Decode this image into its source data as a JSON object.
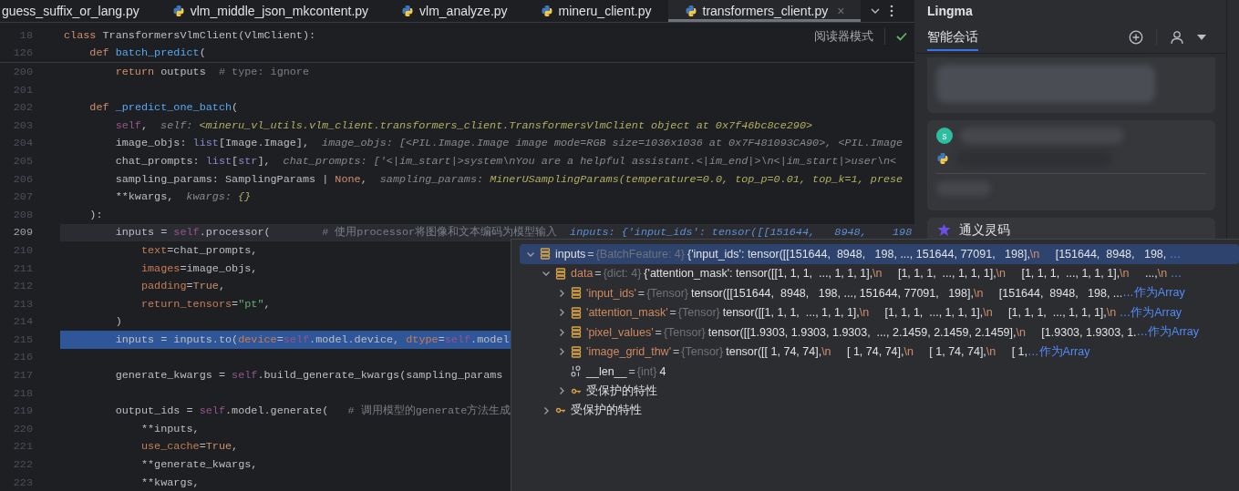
{
  "tabs": [
    {
      "label": "guess_suffix_or_lang.py",
      "icon": false,
      "selected": false
    },
    {
      "label": "vlm_middle_json_mkcontent.py",
      "icon": true,
      "selected": false
    },
    {
      "label": "vlm_analyze.py",
      "icon": true,
      "selected": false
    },
    {
      "label": "mineru_client.py",
      "icon": true,
      "selected": false
    },
    {
      "label": "transformers_client.py",
      "icon": true,
      "selected": true,
      "close": "×"
    }
  ],
  "editor": {
    "reader_mode": "阅读器模式",
    "sticky_lines": [
      {
        "number": "18",
        "execution_point": false,
        "caret_line": false,
        "tokens": [
          {
            "text": "class",
            "kind": "kw"
          },
          {
            "text": " TransformersVlmClient(VlmClient):",
            "kind": "plain"
          }
        ]
      },
      {
        "number": "126",
        "execution_point": false,
        "caret_line": false,
        "tokens": [
          {
            "text": "    def",
            "kind": "kw"
          },
          {
            "text": " batch_predict",
            "kind": "fn"
          },
          {
            "text": "(",
            "kind": "plain"
          }
        ]
      }
    ],
    "lines": [
      {
        "number": "200",
        "execution_point": false,
        "caret_line": false,
        "tokens": [
          {
            "text": "        return",
            "kind": "kw"
          },
          {
            "text": " outputs  ",
            "kind": "plain"
          },
          {
            "text": "# type: ignore",
            "kind": "cmt"
          }
        ]
      },
      {
        "number": "201",
        "execution_point": false,
        "caret_line": false
      },
      {
        "number": "202",
        "execution_point": false,
        "caret_line": false,
        "tokens": [
          {
            "text": "    def",
            "kind": "kw"
          },
          {
            "text": " _predict_one_batch",
            "kind": "fn"
          },
          {
            "text": "(",
            "kind": "plain"
          }
        ]
      },
      {
        "number": "203",
        "execution_point": false,
        "caret_line": false,
        "tokens": [
          {
            "text": "        self",
            "kind": "self"
          },
          {
            "text": ",",
            "kind": "plain"
          }
        ],
        "hint": {
          "kind": "inlay",
          "segments": [
            {
              "text": "self: ",
              "kind": "name"
            },
            {
              "text": "<mineru_vl_utils.vlm_client.transformers_client.TransformersVlmClient object at 0x7f46bc8ce290>",
              "kind": "value"
            }
          ]
        }
      },
      {
        "number": "204",
        "execution_point": false,
        "caret_line": false,
        "tokens": [
          {
            "text": "        image_objs: ",
            "kind": "plain"
          },
          {
            "text": "list",
            "kind": "builtin"
          },
          {
            "text": "[Image.Image],",
            "kind": "plain"
          }
        ],
        "hint": {
          "kind": "inlay",
          "segments": [
            {
              "text": "image_objs: [<PIL.Image.Image image mode=RGB size=1036x1036 at 0x7F481093CA90>, <PIL.Image",
              "kind": "name"
            }
          ]
        }
      },
      {
        "number": "205",
        "execution_point": false,
        "caret_line": false,
        "tokens": [
          {
            "text": "        chat_prompts: ",
            "kind": "plain"
          },
          {
            "text": "list",
            "kind": "builtin"
          },
          {
            "text": "[",
            "kind": "plain"
          },
          {
            "text": "str",
            "kind": "builtin"
          },
          {
            "text": "],",
            "kind": "plain"
          }
        ],
        "hint": {
          "kind": "inlay",
          "segments": [
            {
              "text": "chat_prompts: ['<|im_start|>system\\nYou are a helpful assistant.<|im_end|>\\n<|im_start|>user\\n<",
              "kind": "name"
            }
          ]
        }
      },
      {
        "number": "206",
        "execution_point": false,
        "caret_line": false,
        "tokens": [
          {
            "text": "        sampling_params: SamplingParams | ",
            "kind": "plain"
          },
          {
            "text": "None",
            "kind": "kw"
          },
          {
            "text": ",",
            "kind": "plain"
          }
        ],
        "hint": {
          "kind": "inlay",
          "segments": [
            {
              "text": "sampling_params: ",
              "kind": "name"
            },
            {
              "text": "MinerUSamplingParams(temperature=0.0, top_p=0.01, top_k=1, prese",
              "kind": "value"
            }
          ]
        }
      },
      {
        "number": "207",
        "execution_point": false,
        "caret_line": false,
        "tokens": [
          {
            "text": "        **kwargs,",
            "kind": "plain"
          }
        ],
        "hint": {
          "kind": "inlay",
          "segments": [
            {
              "text": "kwargs: ",
              "kind": "name"
            },
            {
              "text": "{}",
              "kind": "value"
            }
          ]
        }
      },
      {
        "number": "208",
        "execution_point": false,
        "caret_line": false,
        "tokens": [
          {
            "text": "    ):",
            "kind": "plain"
          }
        ]
      },
      {
        "number": "209",
        "execution_point": false,
        "caret_line": true,
        "tokens": [
          {
            "text": "        inputs = ",
            "kind": "plain"
          },
          {
            "text": "self",
            "kind": "self"
          },
          {
            "text": ".processor(",
            "kind": "plain"
          },
          {
            "text": "        # 使用processor将图像和文本编码为模型输入",
            "kind": "cmt"
          }
        ],
        "hint": {
          "kind": "debug",
          "segments": [
            {
              "text": "inputs: {'input_ids': tensor([[151644,   8948,    198",
              "kind": "value"
            }
          ]
        }
      },
      {
        "number": "210",
        "execution_point": false,
        "caret_line": false,
        "tokens": [
          {
            "text": "            text",
            "kind": "param"
          },
          {
            "text": "=chat_prompts,",
            "kind": "plain"
          }
        ]
      },
      {
        "number": "211",
        "execution_point": false,
        "caret_line": false,
        "tokens": [
          {
            "text": "            images",
            "kind": "param"
          },
          {
            "text": "=image_objs,",
            "kind": "plain"
          }
        ]
      },
      {
        "number": "212",
        "execution_point": false,
        "caret_line": false,
        "tokens": [
          {
            "text": "            padding",
            "kind": "param"
          },
          {
            "text": "=",
            "kind": "plain"
          },
          {
            "text": "True",
            "kind": "kw"
          },
          {
            "text": ",",
            "kind": "plain"
          }
        ]
      },
      {
        "number": "213",
        "execution_point": false,
        "caret_line": false,
        "tokens": [
          {
            "text": "            return_tensors",
            "kind": "param"
          },
          {
            "text": "=",
            "kind": "plain"
          },
          {
            "text": "\"pt\"",
            "kind": "str"
          },
          {
            "text": ",",
            "kind": "plain"
          }
        ]
      },
      {
        "number": "214",
        "execution_point": false,
        "caret_line": false,
        "tokens": [
          {
            "text": "        )",
            "kind": "plain"
          }
        ]
      },
      {
        "number": "215",
        "execution_point": true,
        "caret_line": false,
        "tokens": [
          {
            "text": "        inputs = inputs.to(",
            "kind": "plain"
          },
          {
            "text": "device",
            "kind": "param"
          },
          {
            "text": "=",
            "kind": "plain"
          },
          {
            "text": "self",
            "kind": "self"
          },
          {
            "text": ".model.device, ",
            "kind": "plain"
          },
          {
            "text": "dtype",
            "kind": "param"
          },
          {
            "text": "=",
            "kind": "plain"
          },
          {
            "text": "self",
            "kind": "self"
          },
          {
            "text": ".model",
            "kind": "plain"
          }
        ]
      },
      {
        "number": "216",
        "execution_point": false,
        "caret_line": false
      },
      {
        "number": "217",
        "execution_point": false,
        "caret_line": false,
        "tokens": [
          {
            "text": "        generate_kwargs = ",
            "kind": "plain"
          },
          {
            "text": "self",
            "kind": "self"
          },
          {
            "text": ".build_generate_kwargs(sampling_params",
            "kind": "plain"
          }
        ]
      },
      {
        "number": "218",
        "execution_point": false,
        "caret_line": false
      },
      {
        "number": "219",
        "execution_point": false,
        "caret_line": false,
        "tokens": [
          {
            "text": "        output_ids = ",
            "kind": "plain"
          },
          {
            "text": "self",
            "kind": "self"
          },
          {
            "text": ".model.generate(",
            "kind": "plain"
          },
          {
            "text": "   # 调用模型的generate方法生成",
            "kind": "cmt"
          }
        ]
      },
      {
        "number": "220",
        "execution_point": false,
        "caret_line": false,
        "tokens": [
          {
            "text": "            **inputs,",
            "kind": "plain"
          }
        ]
      },
      {
        "number": "221",
        "execution_point": false,
        "caret_line": false,
        "tokens": [
          {
            "text": "            use_cache",
            "kind": "param"
          },
          {
            "text": "=",
            "kind": "plain"
          },
          {
            "text": "True",
            "kind": "kw"
          },
          {
            "text": ",",
            "kind": "plain"
          }
        ]
      },
      {
        "number": "222",
        "execution_point": false,
        "caret_line": false,
        "tokens": [
          {
            "text": "            **generate_kwargs,",
            "kind": "plain"
          }
        ]
      },
      {
        "number": "223",
        "execution_point": false,
        "caret_line": false,
        "tokens": [
          {
            "text": "            **kwargs,",
            "kind": "plain"
          }
        ]
      }
    ]
  },
  "debugger": {
    "variables": [
      {
        "kind": "field",
        "name": "inputs",
        "sep": "=",
        "type": "{BatchFeature: 4}",
        "value": "{'input_ids': tensor([[151644,  8948,   198, ..., 151644, 77091,   198],\\n     [151644,  8948,   198, ",
        "link": "…",
        "selected": true,
        "expanded": true,
        "children": [
          {
            "kind": "field",
            "name": "data",
            "sep": "=",
            "type": "{dict: 4}",
            "value": "{'attention_mask': tensor([[1, 1, 1,  ..., 1, 1, 1],\\n     [1, 1, 1,  ..., 1, 1, 1],\\n     [1, 1, 1,  ..., 1, 1, 1],\\n     ...,\\n ",
            "link": "…",
            "selected": false,
            "expanded": true,
            "children": [
              {
                "kind": "field",
                "name": "'input_ids'",
                "sep": "=",
                "type": "{Tensor}",
                "value": "tensor([[151644,  8948,   198, ..., 151644, 77091,   198],\\n     [151644,  8948,   198, ...",
                "link": "…作为Array",
                "selected": false,
                "expanded": false
              },
              {
                "kind": "field",
                "name": "'attention_mask'",
                "sep": "=",
                "type": "{Tensor}",
                "value": "tensor([[1, 1, 1,  ..., 1, 1, 1],\\n     [1, 1, 1,  ..., 1, 1, 1],\\n     [1, 1, 1,  ..., 1, 1, 1],\\n ",
                "link": "…作为Array",
                "selected": false,
                "expanded": false
              },
              {
                "kind": "field",
                "name": "'pixel_values'",
                "sep": "=",
                "type": "{Tensor}",
                "value": "tensor([[1.9303, 1.9303, 1.9303,  ..., 2.1459, 2.1459, 2.1459],\\n     [1.9303, 1.9303, 1.",
                "link": "…作为Array",
                "selected": false,
                "expanded": false
              },
              {
                "kind": "field",
                "name": "'image_grid_thw'",
                "sep": "=",
                "type": "{Tensor}",
                "value": "tensor([[ 1, 74, 74],\\n     [ 1, 74, 74],\\n     [ 1, 74, 74],\\n     [ 1,",
                "link": "…作为Array",
                "selected": false,
                "expanded": false
              },
              {
                "kind": "int",
                "name": "__len__",
                "sep": "=",
                "type": "{int}",
                "value": "4",
                "selected": false
              },
              {
                "kind": "protected",
                "name": "受保护的特性",
                "selected": false,
                "expanded": false
              }
            ]
          },
          {
            "kind": "protected",
            "name": "受保护的特性",
            "selected": false,
            "expanded": false
          }
        ]
      }
    ]
  },
  "assistant": {
    "title": "Lingma",
    "tabs": [
      {
        "label": "智能会话",
        "selected": true
      }
    ],
    "cards": [
      {
        "kind": "redacted"
      },
      {
        "kind": "message",
        "avatar": "s"
      },
      {
        "kind": "brand",
        "label": "通义灵码"
      }
    ]
  }
}
